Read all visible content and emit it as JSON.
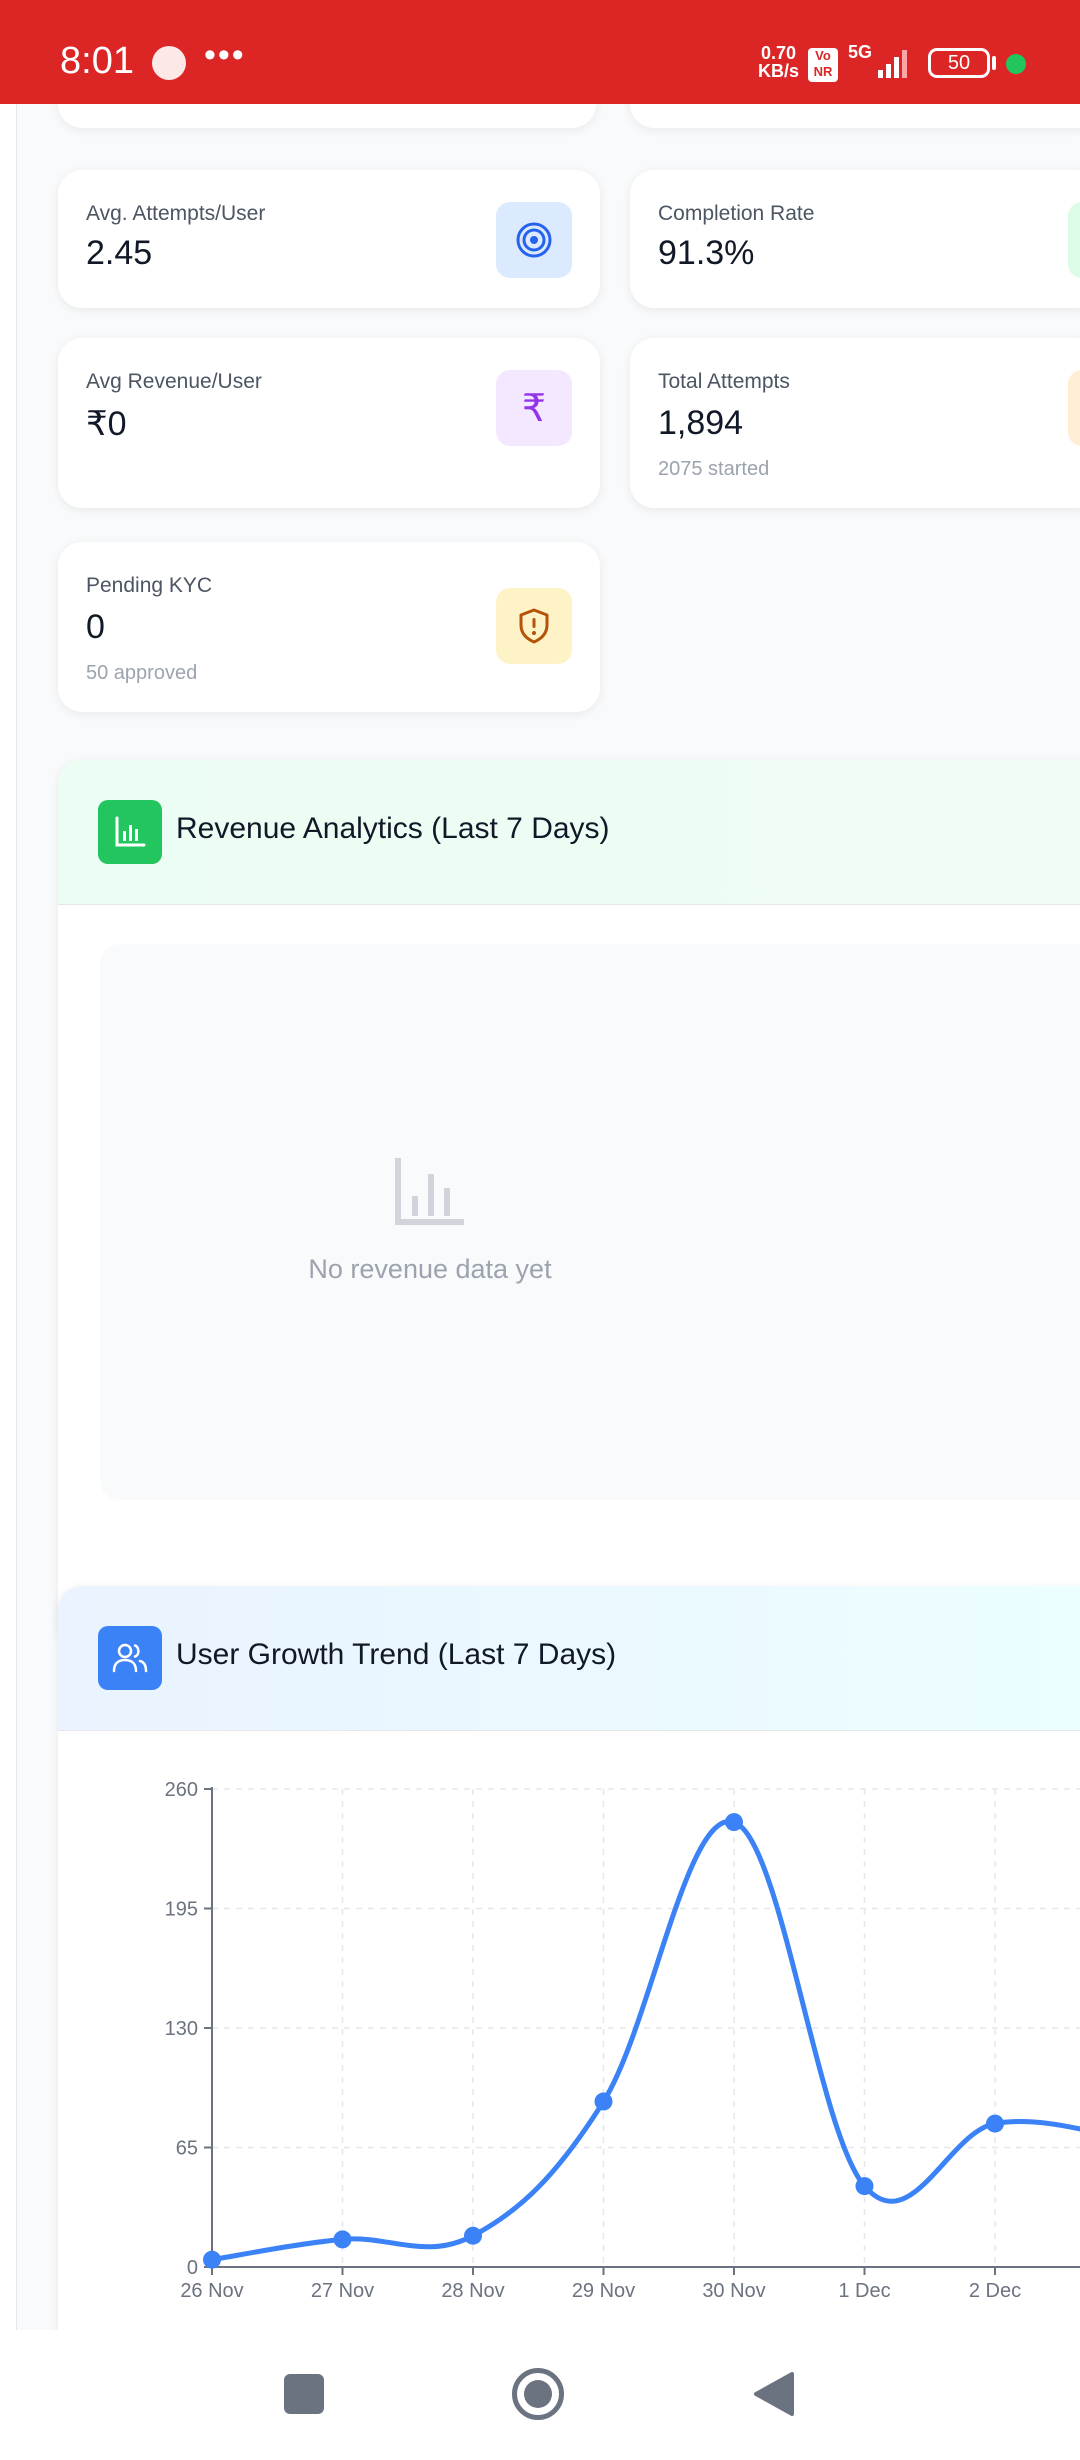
{
  "status_bar": {
    "time": "8:01",
    "more": "•••",
    "speed_value": "0.70",
    "speed_unit": "KB/s",
    "volte": "Vo NR",
    "network": "5G",
    "battery": "50"
  },
  "stats": [
    {
      "title": "Avg. Attempts/User",
      "value": "2.45",
      "sub": "",
      "icon": "target-icon",
      "icon_bg": "#dbeafe",
      "icon_color": "#2563eb"
    },
    {
      "title": "Completion Rate",
      "value": "91.3%",
      "sub": "",
      "icon": "check-icon",
      "icon_bg": "#dcfce7",
      "icon_color": "#16a34a"
    },
    {
      "title": "Avg Revenue/User",
      "value": "₹0",
      "sub": "",
      "icon": "rupee-icon",
      "icon_bg": "#f3e8ff",
      "icon_color": "#9333ea",
      "glyph": "₹"
    },
    {
      "title": "Total Attempts",
      "value": "1,894",
      "sub": "2075 started",
      "icon": "attempts-icon",
      "icon_bg": "#ffedd5",
      "icon_color": "#ea580c"
    },
    {
      "title": "Pending KYC",
      "value": "0",
      "sub": "50 approved",
      "icon": "shield-alert-icon",
      "icon_bg": "#fef3c7",
      "icon_color": "#b45309"
    }
  ],
  "revenue": {
    "title": "Revenue Analytics (Last 7 Days)",
    "icon": "bar-chart-icon",
    "accent": "#22c55e",
    "empty_text": "No revenue data yet"
  },
  "growth": {
    "title": "User Growth Trend (Last 7 Days)",
    "icon": "users-icon",
    "accent": "#3b82f6"
  },
  "chart_data": {
    "type": "line",
    "title": "",
    "xlabel": "",
    "ylabel": "",
    "categories": [
      "26 Nov",
      "27 Nov",
      "28 Nov",
      "29 Nov",
      "30 Nov",
      "1 Dec",
      "2 Dec"
    ],
    "series": [
      {
        "values": [
          4,
          15,
          17,
          90,
          242,
          44,
          78
        ],
        "color": "#3b82f6"
      }
    ],
    "y_ticks": [
      0,
      65,
      130,
      195,
      260
    ],
    "ylim": [
      0,
      260
    ],
    "grid": true,
    "trailing_point_clipped": 70
  },
  "navbar": {
    "recent": "square-icon",
    "home": "circle-icon",
    "back": "triangle-back-icon"
  }
}
